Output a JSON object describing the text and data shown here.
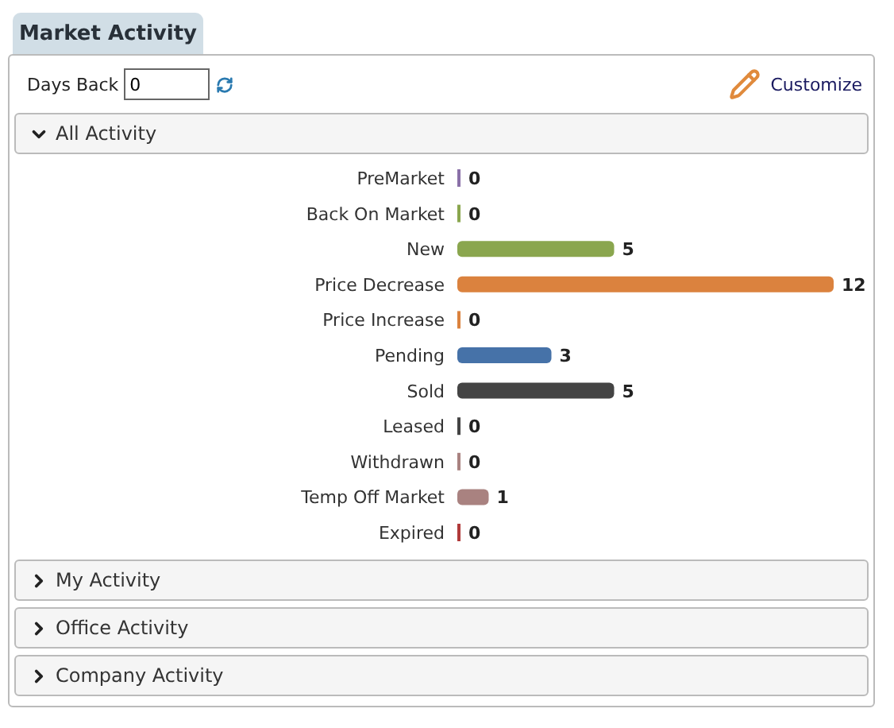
{
  "tab": {
    "title": "Market Activity"
  },
  "toolbar": {
    "days_back_label": "Days Back",
    "days_back_value": "0",
    "customize": "Customize"
  },
  "sections": [
    {
      "title": "All Activity",
      "expanded": true,
      "chart_data": {
        "type": "bar",
        "orientation": "horizontal",
        "data_labels": true,
        "categories": [
          "PreMarket",
          "Back On Market",
          "New",
          "Price Decrease",
          "Price Increase",
          "Pending",
          "Sold",
          "Leased",
          "Withdrawn",
          "Temp Off Market",
          "Expired"
        ],
        "values": [
          0,
          0,
          5,
          12,
          0,
          3,
          5,
          0,
          0,
          1,
          0
        ],
        "colors": [
          "#8a70a8",
          "#8aa64e",
          "#8aa64e",
          "#db823e",
          "#db823e",
          "#4672a8",
          "#444444",
          "#444444",
          "#a98280",
          "#a98280",
          "#b03a3a"
        ]
      }
    },
    {
      "title": "My Activity",
      "expanded": false
    },
    {
      "title": "Office Activity",
      "expanded": false
    },
    {
      "title": "Company Activity",
      "expanded": false
    }
  ]
}
